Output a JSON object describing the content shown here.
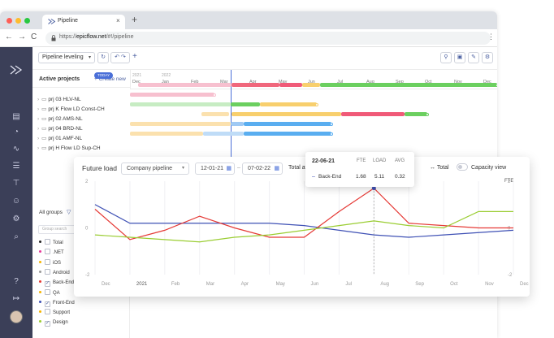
{
  "browser": {
    "tab_title": "Pipeline",
    "tab_close": "×",
    "new_tab": "+",
    "url_prefix": "https://",
    "url_domain": "epicflow.net",
    "url_path": "/#!/pipeline",
    "colors": {
      "close": "#ff5f57",
      "minimize": "#febc2e",
      "maximize": "#28c840"
    }
  },
  "toolbar": {
    "mode_select": "Pipeline leveling",
    "add_label": "+"
  },
  "projects": {
    "header": "Active projects",
    "create_label": "+ Create new",
    "items": [
      "prj 03 HLV-NL",
      "prj K Flow LD Const-CH",
      "prj 02 AMS-NL",
      "prj 04 BRD-NL",
      "prj 01 AMF-NL",
      "prj H Flow LD Sup-CH"
    ]
  },
  "timeline": {
    "years": [
      "2021",
      "2022"
    ],
    "months": [
      "Dec",
      "Jan",
      "Feb",
      "Mar",
      "Apr",
      "May",
      "Jun",
      "Jul",
      "Aug",
      "Sep",
      "Oct",
      "Nov",
      "Dec"
    ],
    "today_label": "TODAY"
  },
  "groups": {
    "header": "All groups",
    "search_placeholder": "Group search",
    "items": [
      {
        "label": "Total",
        "checked": false,
        "color": "#222222"
      },
      {
        "label": ".NET",
        "checked": false,
        "color": "#e6399b"
      },
      {
        "label": "iOS",
        "checked": false,
        "color": "#f5b400"
      },
      {
        "label": "Android",
        "checked": false,
        "color": "#999999"
      },
      {
        "label": "Back-End",
        "checked": true,
        "color": "#e53935"
      },
      {
        "label": "QA",
        "checked": false,
        "color": "#f5b400"
      },
      {
        "label": "Front-End",
        "checked": true,
        "color": "#3f51b5"
      },
      {
        "label": "Support",
        "checked": false,
        "color": "#f5b400"
      },
      {
        "label": "Design",
        "checked": true,
        "color": "#9acd32"
      }
    ]
  },
  "future_load": {
    "title": "Future load",
    "pipeline_select": "Company pipeline",
    "date_from": "12-01-21",
    "date_to": "07-02-22",
    "total_avg_label": "Total avg",
    "total_toggle": "Total",
    "capacity_toggle": "Capacity view",
    "unit_label": "FTE",
    "y_ticks": [
      "2",
      "0",
      "-2"
    ],
    "x_ticks": [
      "Dec",
      "2021",
      "Feb",
      "Mar",
      "Apr",
      "May",
      "Jun",
      "Jul",
      "Aug",
      "Sep",
      "Oct",
      "Nov",
      "Dec"
    ]
  },
  "tooltip": {
    "date": "22-06-21",
    "col_fte": "FTE",
    "col_load": "LOAD",
    "col_avg": "AVG",
    "row_label": "Back-End",
    "row_fte": "1.68",
    "row_load": "5.11",
    "row_avg": "0.32"
  },
  "chart_data": {
    "type": "line",
    "x": [
      "Dec",
      "2021",
      "Feb",
      "Mar",
      "Apr",
      "May",
      "Jun",
      "Jul",
      "Aug",
      "Sep",
      "Oct",
      "Nov",
      "Dec"
    ],
    "ylabel": "FTE",
    "ylim": [
      -2,
      2
    ],
    "series": [
      {
        "color": "#3f51b5",
        "values": [
          1.0,
          0.2,
          0.2,
          0.2,
          0.2,
          0.2,
          0.1,
          -0.1,
          -0.3,
          -0.4,
          -0.3,
          -0.2,
          -0.1
        ]
      },
      {
        "color": "#e53935",
        "values": [
          0.8,
          -0.5,
          -0.1,
          0.5,
          0.0,
          -0.4,
          -0.4,
          0.7,
          1.7,
          0.2,
          0.1,
          0.0,
          0.0
        ]
      },
      {
        "color": "#9acd32",
        "values": [
          -0.3,
          -0.4,
          -0.5,
          -0.6,
          -0.4,
          -0.3,
          -0.1,
          0.1,
          0.3,
          0.1,
          0.0,
          0.7,
          0.7
        ]
      }
    ]
  }
}
